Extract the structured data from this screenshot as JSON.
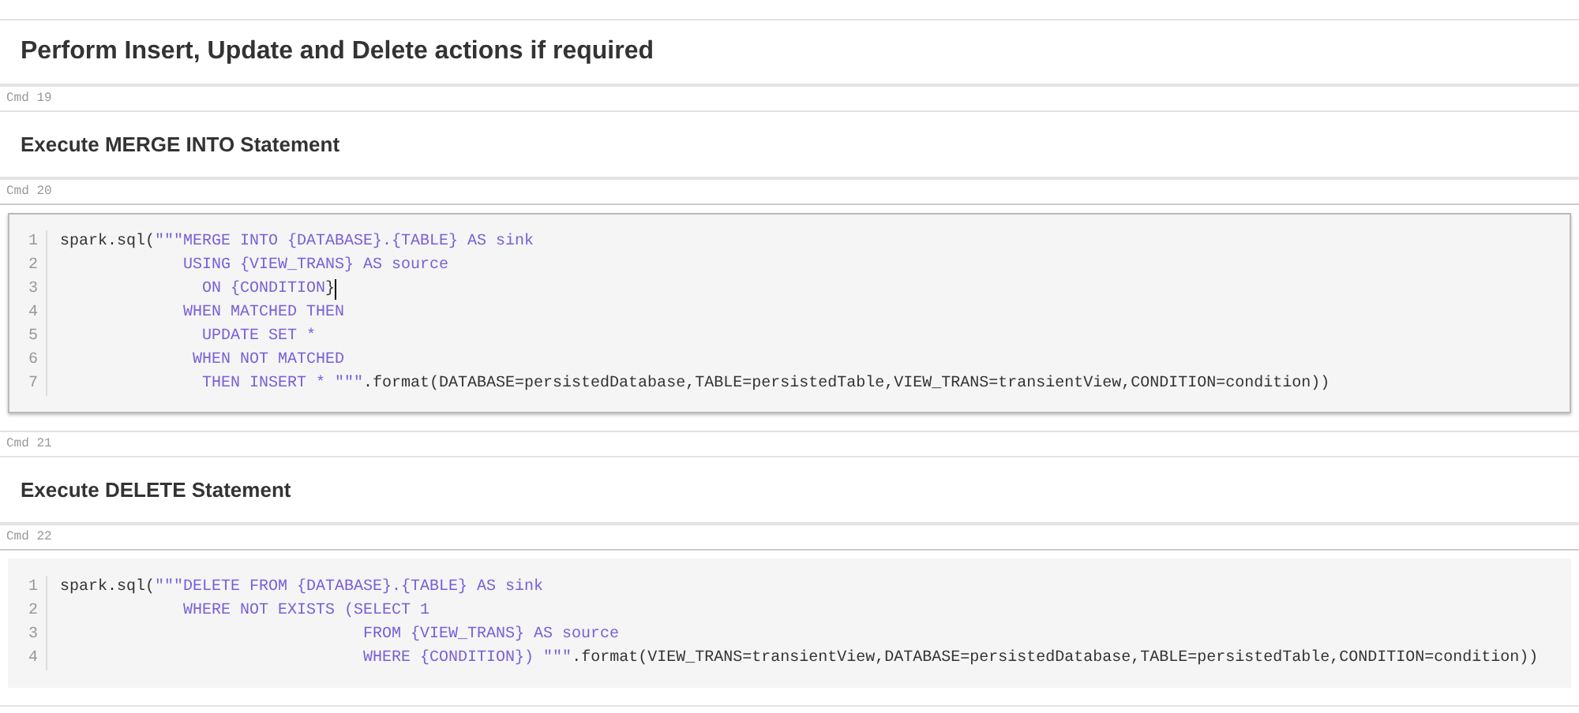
{
  "cells": [
    {
      "kind": "title",
      "text": "Perform Insert, Update and Delete actions if required",
      "selected": false
    },
    {
      "label": "Cmd 19",
      "kind": "subtitle",
      "text": "Execute MERGE INTO Statement",
      "selected": false
    },
    {
      "label": "Cmd 20",
      "kind": "code",
      "selected": true,
      "lines": [
        {
          "number": "1",
          "segments": [
            {
              "kind": "code",
              "text": "spark.sql("
            },
            {
              "kind": "string",
              "text": "\"\"\"MERGE INTO {DATABASE}.{TABLE} AS sink"
            }
          ]
        },
        {
          "number": "2",
          "segments": [
            {
              "kind": "string",
              "text": "             USING {VIEW_TRANS} AS source"
            }
          ]
        },
        {
          "number": "3",
          "segments": [
            {
              "kind": "string",
              "text": "               ON {CONDITION"
            },
            {
              "kind": "code",
              "text": "}"
            }
          ],
          "cursor": true
        },
        {
          "number": "4",
          "segments": [
            {
              "kind": "string",
              "text": "             WHEN MATCHED THEN"
            }
          ]
        },
        {
          "number": "5",
          "segments": [
            {
              "kind": "string",
              "text": "               UPDATE SET *"
            }
          ]
        },
        {
          "number": "6",
          "segments": [
            {
              "kind": "string",
              "text": "              WHEN NOT MATCHED"
            }
          ]
        },
        {
          "number": "7",
          "segments": [
            {
              "kind": "string",
              "text": "               THEN INSERT * \"\"\""
            },
            {
              "kind": "code",
              "text": ".format(DATABASE=persistedDatabase,TABLE=persistedTable,VIEW_TRANS=transientView,CONDITION=condition))"
            }
          ]
        }
      ]
    },
    {
      "label": "Cmd 21",
      "kind": "subtitle",
      "text": "Execute DELETE Statement",
      "selected": false
    },
    {
      "label": "Cmd 22",
      "kind": "code",
      "selected": false,
      "lines": [
        {
          "number": "1",
          "segments": [
            {
              "kind": "code",
              "text": "spark.sql("
            },
            {
              "kind": "string",
              "text": "\"\"\"DELETE FROM {DATABASE}.{TABLE} AS sink"
            }
          ]
        },
        {
          "number": "2",
          "segments": [
            {
              "kind": "string",
              "text": "             WHERE NOT EXISTS (SELECT 1"
            }
          ]
        },
        {
          "number": "3",
          "segments": [
            {
              "kind": "string",
              "text": "                                FROM {VIEW_TRANS} AS source"
            }
          ]
        },
        {
          "number": "4",
          "segments": [
            {
              "kind": "string",
              "text": "                                WHERE {CONDITION}) \"\"\""
            },
            {
              "kind": "code",
              "text": ".format(VIEW_TRANS=transientView,DATABASE=persistedDatabase,TABLE=persistedTable,CONDITION=condition))"
            }
          ]
        }
      ]
    }
  ]
}
